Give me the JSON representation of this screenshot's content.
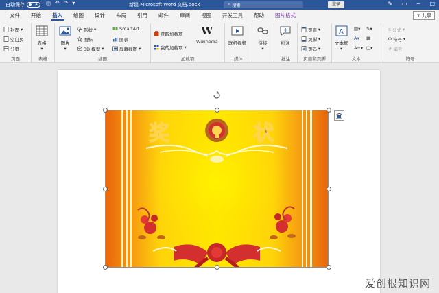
{
  "titlebar": {
    "autosave_label": "自动保存",
    "autosave_state": "关",
    "doc_title": "新建 Microsoft Word 文档.docx",
    "search_placeholder": "搜索",
    "login_label": "登录",
    "colors": {
      "bar": "#2b579a"
    }
  },
  "tabs": [
    {
      "label": "文件"
    },
    {
      "label": "开始"
    },
    {
      "label": "插入",
      "active": true
    },
    {
      "label": "绘图"
    },
    {
      "label": "设计"
    },
    {
      "label": "布局"
    },
    {
      "label": "引用"
    },
    {
      "label": "邮件"
    },
    {
      "label": "审阅"
    },
    {
      "label": "视图"
    },
    {
      "label": "开发工具"
    },
    {
      "label": "帮助"
    },
    {
      "label": "图片格式"
    }
  ],
  "share_label": "共享",
  "ribbon": {
    "pages": {
      "label": "页面",
      "items": [
        "封面",
        "空白页",
        "分页"
      ]
    },
    "tables": {
      "label": "表格",
      "table": "表格"
    },
    "illustrations": {
      "label": "插图",
      "picture": "图片",
      "shapes": "形状",
      "icons": "图标",
      "model3d": "3D 模型",
      "smartart": "SmartArt",
      "chart": "图表",
      "screenshot": "屏幕截图"
    },
    "addins": {
      "label": "加载项",
      "get": "获取加载项",
      "my": "我的加载项",
      "wikipedia": "Wikipedia"
    },
    "media": {
      "label": "媒体",
      "video": "联机视频"
    },
    "links": {
      "label": "",
      "link": "链接"
    },
    "comments": {
      "label": "批注",
      "comment": "批注"
    },
    "header_footer": {
      "label": "页眉和页脚",
      "header": "页眉",
      "footer": "页脚",
      "page_number": "页码"
    },
    "text": {
      "label": "文本",
      "textbox": "文本框"
    },
    "symbols": {
      "label": "符号",
      "equation": "公式",
      "symbol": "符号",
      "number": "编号"
    }
  },
  "document": {
    "certificate_title": "奖 状",
    "watermark": "爱创根知识网"
  }
}
